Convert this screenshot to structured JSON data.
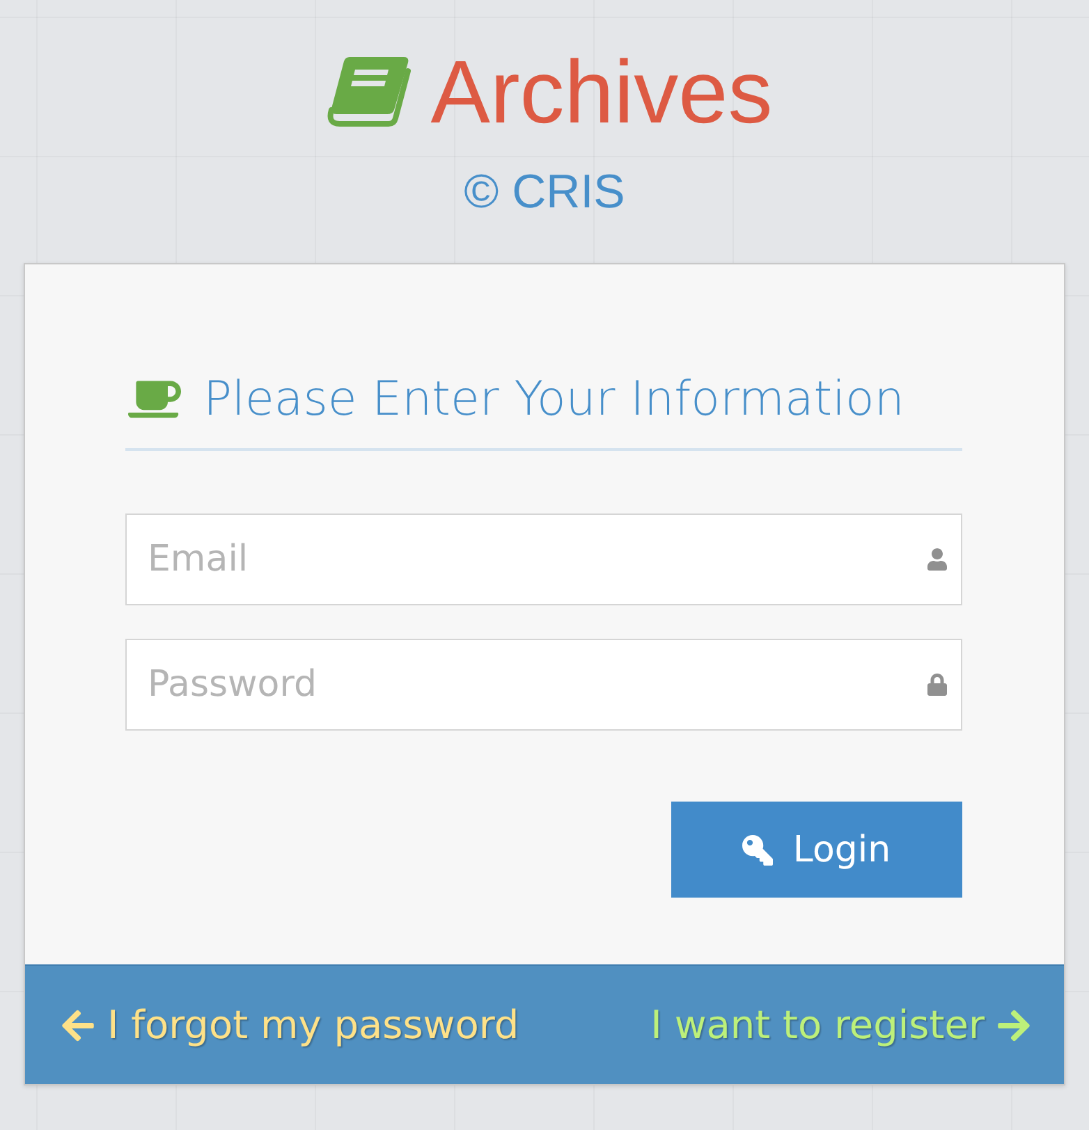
{
  "header": {
    "title": "Archives",
    "subtitle": "© CRIS"
  },
  "form": {
    "heading": "Please Enter Your Information",
    "fields": [
      {
        "kind": "email",
        "placeholder": "Email"
      },
      {
        "kind": "password",
        "placeholder": "Password"
      }
    ],
    "submit": "Login"
  },
  "footer": {
    "links": [
      {
        "kind": "back",
        "label": "I forgot my password"
      },
      {
        "kind": "forward",
        "label": "I want to register"
      }
    ]
  }
}
